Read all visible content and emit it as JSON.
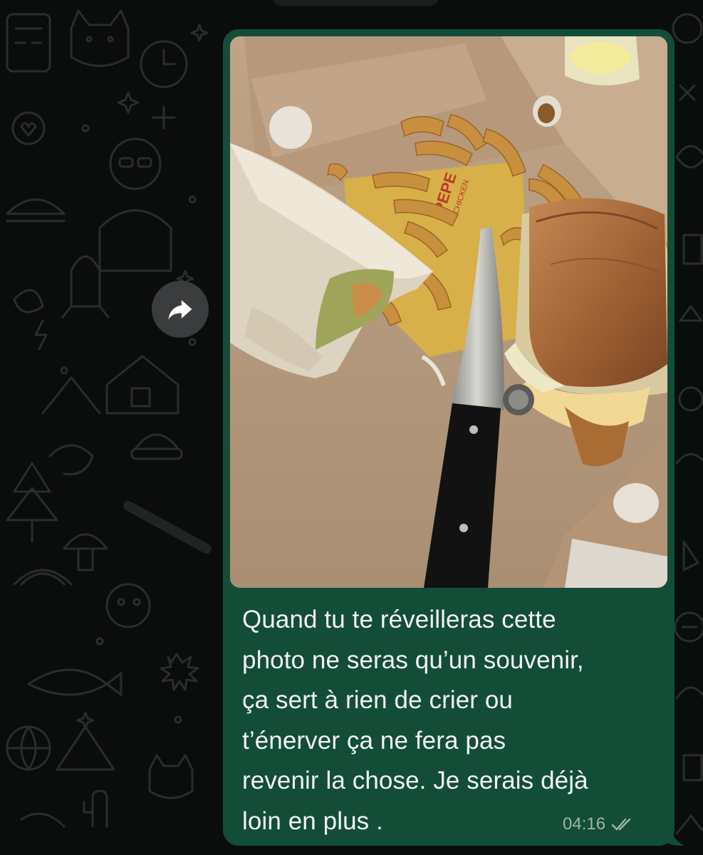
{
  "chat": {
    "forward_icon": "forward-arrow-icon",
    "message": {
      "photo_description_icon": "food-photo",
      "text": "Quand tu te réveilleras cette\nphoto ne seras qu’un souvenir,\nça sert à rien de crier ou\nt’énerver ça ne fera pas\nrevenir la chose. Je serais déjà\nloin en plus .",
      "timestamp": "04:16",
      "status_icon": "double-check-icon",
      "status": "read"
    },
    "photo_labels": {
      "wrapper_brand": "PEPE",
      "wrapper_brand_sub": "CHICKEN"
    }
  },
  "colors": {
    "background": "#0b0c0c",
    "bubble": "#134d37",
    "text": "#f2f4f3",
    "meta": "#9fb5ab",
    "doodle": "#2a2c2c"
  }
}
